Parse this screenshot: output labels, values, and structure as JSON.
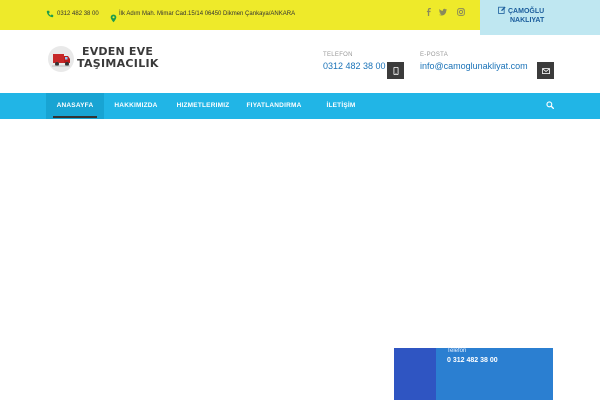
{
  "topbar": {
    "phone": "0312 482 38 00",
    "address": "İlk Adım Mah. Mimar Cad.15/14  06450 Dikmen Çankaya/ANKARA",
    "social": [
      "facebook-icon",
      "twitter-icon",
      "instagram-icon"
    ],
    "badge_line1": "ÇAMOĞLU",
    "badge_line2": "NAKLIYAT"
  },
  "header": {
    "logo_line1": "EVDEN EVE",
    "logo_line2": "TAŞIMACILIK",
    "phone_label": "TELEFON",
    "phone_value": "0312 482 38 00",
    "email_label": "E-POSTA",
    "email_value": "info@camoglunakliyat.com"
  },
  "nav": {
    "items": [
      {
        "label": "ANASAYFA",
        "active": true
      },
      {
        "label": "HAKKIMIZDA"
      },
      {
        "label": "HIZMETLERIMIZ"
      },
      {
        "label": "FIYATLANDIRMA"
      },
      {
        "label": "İLETİŞİM"
      }
    ]
  },
  "contact_card": {
    "label": "Telefon",
    "value": "0 312 482 38 00"
  },
  "colors": {
    "topbar": "#eeea2a",
    "nav": "#21b5e6",
    "accent": "#1b73b8",
    "card": "#2b7fd1"
  }
}
